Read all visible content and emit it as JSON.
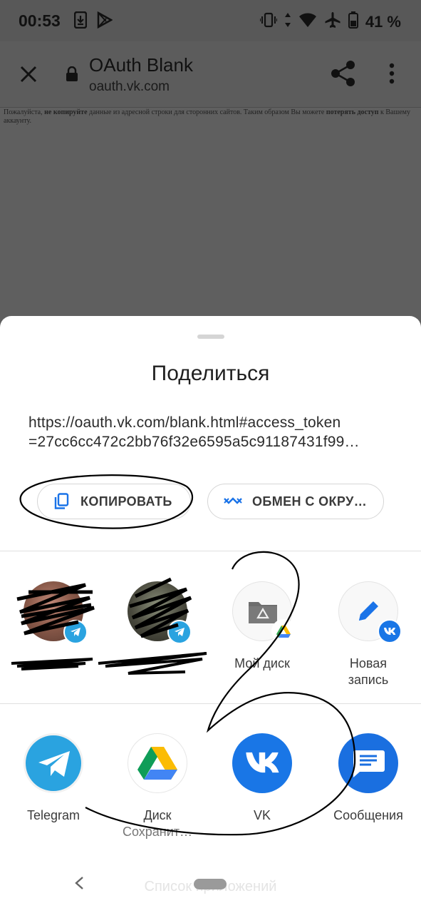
{
  "status_bar": {
    "time": "00:53",
    "battery": "41 %"
  },
  "toolbar": {
    "title": "OAuth Blank",
    "url": "oauth.vk.com"
  },
  "page": {
    "warning_parts": [
      "Пожалуйста, ",
      "не копируйте",
      " данные из адресной строки для сторонних сайтов. Таким образом Вы можете ",
      "потерять доступ",
      " к Вашему аккаунту."
    ]
  },
  "share_sheet": {
    "title": "Поделиться",
    "shared_text_line1": "https://oauth.vk.com/blank.html#access_token",
    "shared_text_line2": "=27cc6cc472c2bb76f32e6595a5c91187431f99…",
    "copy_button": "КОПИРОВАТЬ",
    "nearby_button": "ОБМЕН С ОКРУ…",
    "direct_targets": [
      {
        "label": "Мой диск"
      },
      {
        "label": "Новая",
        "label2": "запись"
      }
    ],
    "apps": [
      {
        "label": "Telegram"
      },
      {
        "label": "Диск",
        "sublabel": "Сохранит…"
      },
      {
        "label": "VK"
      },
      {
        "label": "Сообщения"
      }
    ],
    "app_list_label": "Список приложений"
  },
  "colors": {
    "accent_blue": "#1a73e8",
    "telegram": "#2aa3e0",
    "vk": "#1976e6",
    "messages": "#1a6fe0"
  }
}
